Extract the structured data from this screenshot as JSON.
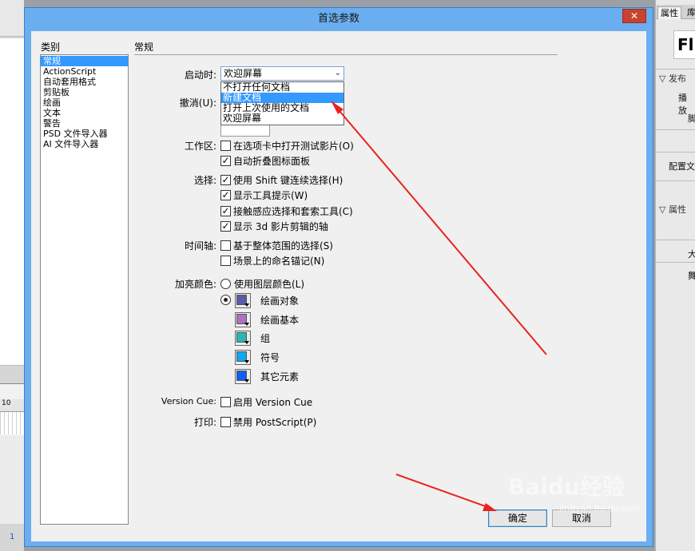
{
  "app": {
    "left_ruler_mark": "10",
    "frame_number": "1",
    "right_panel": {
      "tabs": [
        "属性",
        "库"
      ],
      "logo_text": "Fl",
      "publish_section": "发布",
      "publish_items": [
        "播放",
        "脚"
      ],
      "config_item": "配置文",
      "properties_section": "属性",
      "properties_items": [
        "大",
        "舞"
      ]
    }
  },
  "dialog": {
    "title": "首选参数",
    "close_symbol": "✕",
    "category_label": "类别",
    "categories": [
      "常规",
      "ActionScript",
      "自动套用格式",
      "剪贴板",
      "绘画",
      "文本",
      "警告",
      "PSD 文件导入器",
      "AI 文件导入器"
    ],
    "selected_category": 0,
    "section_title": "常规",
    "startup": {
      "label": "启动时:",
      "selected_value": "欢迎屏幕",
      "arrow": "⌄",
      "options": [
        "不打开任何文档",
        "新建文档",
        "打开上次使用的文档",
        "欢迎屏幕"
      ],
      "highlighted_option": 1
    },
    "undo": {
      "label": "撤消(U):"
    },
    "workspace": {
      "label": "工作区:",
      "items": [
        {
          "text": "在选项卡中打开测试影片(O)",
          "checked": false
        },
        {
          "text": "自动折叠图标面板",
          "checked": true
        }
      ]
    },
    "selection": {
      "label": "选择:",
      "items": [
        {
          "text": "使用 Shift 键连续选择(H)",
          "checked": true
        },
        {
          "text": "显示工具提示(W)",
          "checked": true
        },
        {
          "text": "接触感应选择和套索工具(C)",
          "checked": true
        },
        {
          "text": "显示 3d 影片剪辑的轴",
          "checked": true
        }
      ]
    },
    "timeline": {
      "label": "时间轴:",
      "items": [
        {
          "text": "基于整体范围的选择(S)",
          "checked": false
        },
        {
          "text": "场景上的命名锚记(N)",
          "checked": false
        }
      ]
    },
    "highlight": {
      "label": "加亮颜色:",
      "radio_layer": "使用图层颜色(L)",
      "swatches": [
        {
          "text": "绘画对象",
          "color": "#5b5ba8"
        },
        {
          "text": "绘画基本",
          "color": "#b070c0"
        },
        {
          "text": "组",
          "color": "#28b8b0"
        },
        {
          "text": "符号",
          "color": "#10a8f0"
        },
        {
          "text": "其它元素",
          "color": "#1060f0"
        }
      ]
    },
    "version_cue": {
      "label": "Version Cue:",
      "text": "启用 Version Cue",
      "checked": false
    },
    "print": {
      "label": "打印:",
      "text": "禁用 PostScript(P)",
      "checked": false
    },
    "buttons": {
      "ok": "确定",
      "cancel": "取消"
    },
    "watermark": {
      "main": "Baidu经验",
      "sub": "jingyan.baidu.com"
    }
  },
  "colors": {
    "title_bar": "#6aaef0",
    "selection": "#3399ff",
    "annotation_arrow": "#e8231d"
  }
}
